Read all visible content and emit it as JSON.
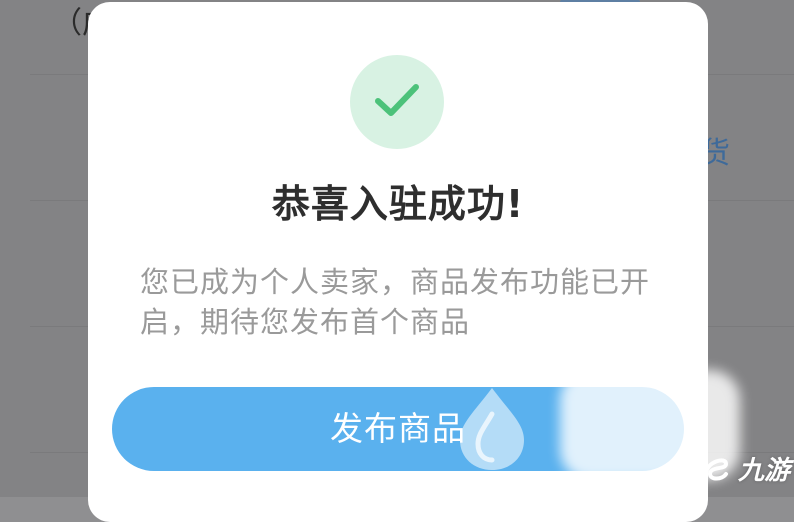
{
  "background": {
    "top_text": "（成",
    "right_text": "货"
  },
  "modal": {
    "icon": "check-icon",
    "title": "恭喜入驻成功!",
    "description": "您已成为个人卖家，商品发布功能已开启，期待您发布首个商品",
    "button_label": "发布商品"
  },
  "watermark": {
    "logo_text": "九游"
  },
  "colors": {
    "accent": "#5ab1ee",
    "success": "#4cc27a",
    "success_bg": "#d8f2e3"
  }
}
